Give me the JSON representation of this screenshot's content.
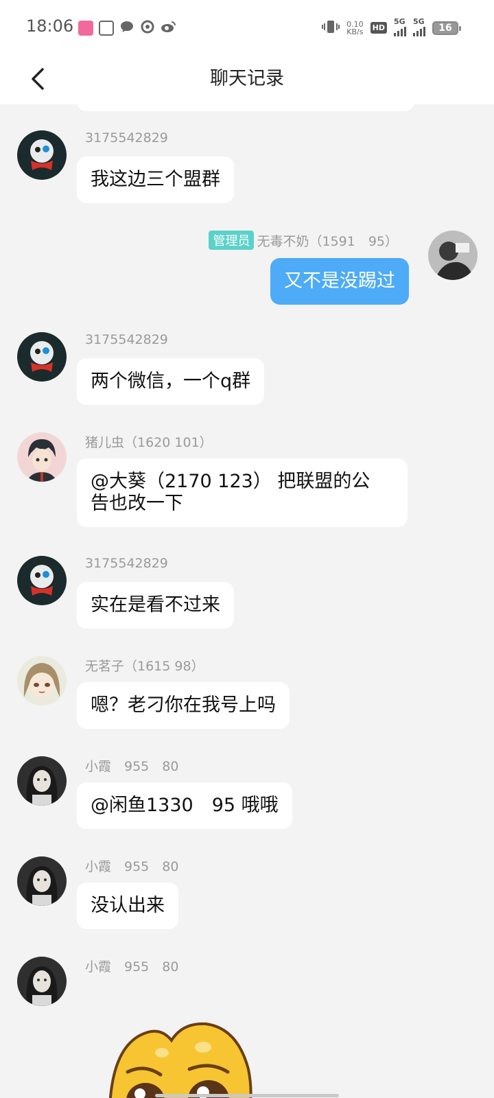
{
  "status_bar": {
    "time": "18:06",
    "net_speed_value": "0.10",
    "net_speed_unit": "KB/s",
    "hd_label": "HD",
    "sim1_label": "5G",
    "sim2_label": "5G",
    "battery": "16"
  },
  "header": {
    "title": "聊天记录",
    "back_icon": "chevron-left-icon"
  },
  "messages": [
    {
      "sender": "3175542829",
      "text": "我这边三个盟群",
      "side": "left"
    },
    {
      "sender": "无毒不奶（1591　95）",
      "badge": "管理员",
      "text": "又不是没踢过",
      "side": "right"
    },
    {
      "sender": "3175542829",
      "text": "两个微信，一个q群",
      "side": "left"
    },
    {
      "sender": "猪儿虫（1620 101）",
      "text_line1": "@大葵（2170 123） 把联盟的公",
      "text_line2": "告也改一下",
      "side": "left"
    },
    {
      "sender": "3175542829",
      "text": "实在是看不过来",
      "side": "left"
    },
    {
      "sender": "无茗子（1615 98）",
      "text": "嗯？老刁你在我号上吗",
      "side": "left"
    },
    {
      "sender": "小霞　955　80",
      "text": "@闲鱼1330　95 哦哦",
      "side": "left"
    },
    {
      "sender": "小霞　955　80",
      "text": "没认出来",
      "side": "left"
    },
    {
      "sender": "小霞　955　80",
      "sticker": "pleading-face-sticker",
      "side": "left"
    }
  ],
  "colors": {
    "background": "#f3f3f3",
    "bubble_left": "#ffffff",
    "bubble_right": "#4dabf7",
    "admin_badge": "#5bd1c9"
  }
}
